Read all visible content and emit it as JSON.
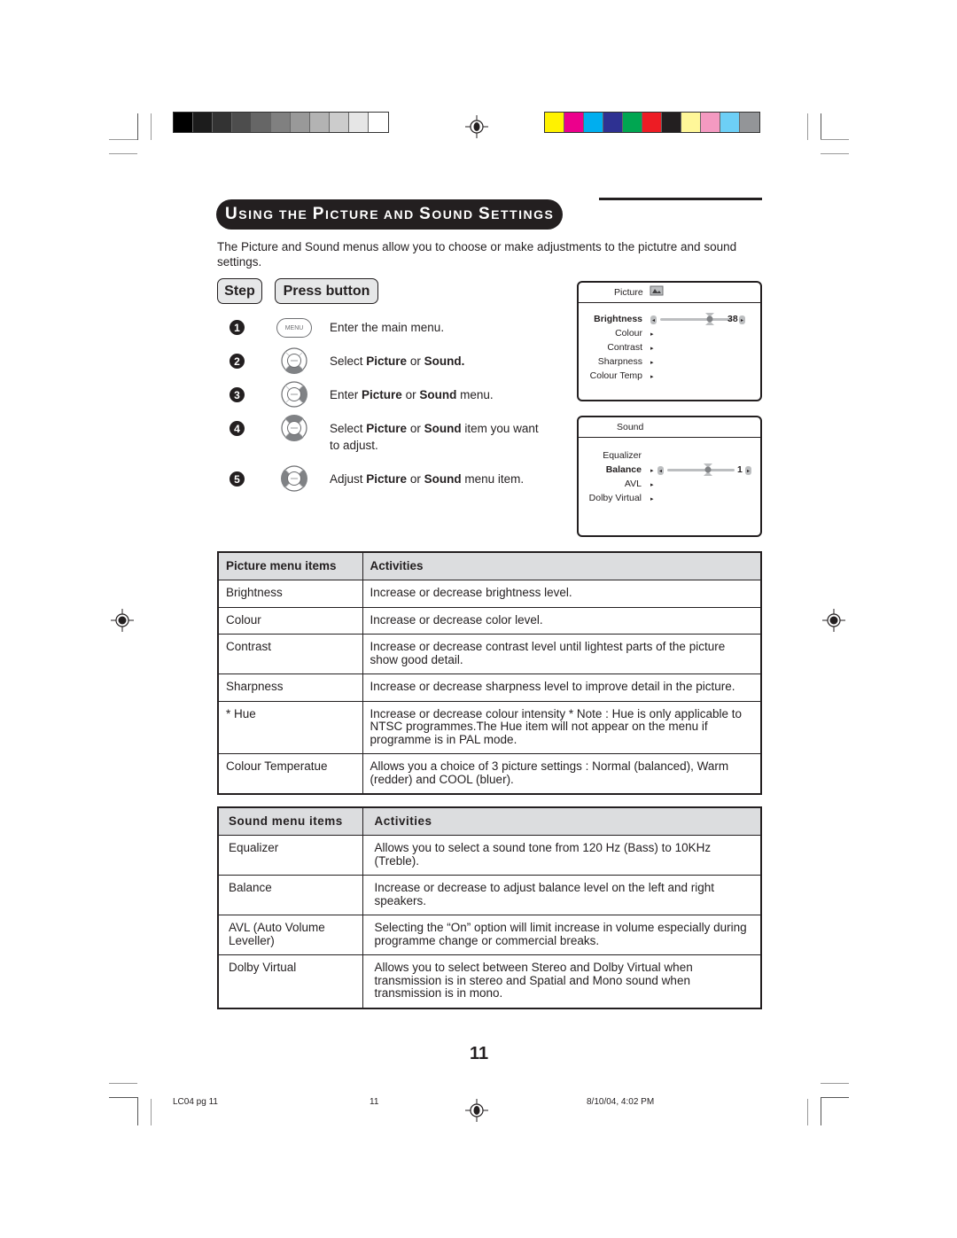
{
  "color_bars": {
    "grayscale": [
      "#000000",
      "#1c1c1c",
      "#333333",
      "#4d4d4d",
      "#666666",
      "#808080",
      "#999999",
      "#b3b3b3",
      "#cccccc",
      "#e6e6e6",
      "#ffffff"
    ],
    "process": [
      "#fff200",
      "#ec008c",
      "#00aeef",
      "#2e3192",
      "#00a651",
      "#ed1c24",
      "#231f20",
      "#fff799",
      "#f49ac1",
      "#6dcff6",
      "#939598"
    ]
  },
  "heading": {
    "parts": [
      {
        "cap": "U",
        "rest": "SING THE "
      },
      {
        "cap": "P",
        "rest": "ICTURE AND "
      },
      {
        "cap": "S",
        "rest": "OUND "
      },
      {
        "cap": "S",
        "rest": "ETTINGS"
      }
    ]
  },
  "intro": "The Picture and Sound menus allow you to choose or make adjustments to the pictutre and sound settings.",
  "step_header": "Step",
  "press_header": "Press button",
  "steps": [
    {
      "num": "1",
      "button": "MENU",
      "button_icon": "menu-button-icon",
      "pre": "Enter the main menu.",
      "bold1": "",
      "mid": "",
      "bold2": "",
      "post": ""
    },
    {
      "num": "2",
      "button": "",
      "button_icon": "nav-down-button-icon",
      "pre": "Select ",
      "bold1": "Picture",
      "mid": " or ",
      "bold2": "Sound.",
      "post": ""
    },
    {
      "num": "3",
      "button": "",
      "button_icon": "nav-right-button-icon",
      "pre": "Enter ",
      "bold1": "Picture",
      "mid": " or ",
      "bold2": "Sound",
      "post": " menu."
    },
    {
      "num": "4",
      "button": "",
      "button_icon": "nav-up-down-button-icon",
      "pre": "Select ",
      "bold1": "Picture",
      "mid": " or ",
      "bold2": "Sound",
      "post": " item you want to adjust."
    },
    {
      "num": "5",
      "button": "",
      "button_icon": "nav-left-right-button-icon",
      "pre": "Adjust ",
      "bold1": "Picture",
      "mid": " or ",
      "bold2": "Sound",
      "post": " menu item."
    }
  ],
  "osd_picture": {
    "title": "Picture",
    "title_icon": "picture-icon",
    "items": [
      {
        "label": "Brightness",
        "active": true
      },
      {
        "label": "Colour",
        "active": false
      },
      {
        "label": "Contrast",
        "active": false
      },
      {
        "label": "Sharpness",
        "active": false
      },
      {
        "label": "Colour Temp",
        "active": false
      }
    ],
    "slider_value": "38",
    "slider_fraction": 0.7
  },
  "osd_sound": {
    "title": "Sound",
    "items": [
      {
        "label": "Equalizer",
        "active": false
      },
      {
        "label": "Balance",
        "active": true
      },
      {
        "label": "AVL",
        "active": false
      },
      {
        "label": "Dolby Virtual",
        "active": false
      }
    ],
    "slider_value": "1",
    "slider_fraction": 0.6
  },
  "picture_table": {
    "headers": [
      "Picture menu items",
      "Activities"
    ],
    "rows": [
      [
        "Brightness",
        "Increase or decrease brightness level."
      ],
      [
        "Colour",
        "Increase or decrease color level."
      ],
      [
        "Contrast",
        "Increase or decrease contrast level  until lightest parts of the picture show good detail."
      ],
      [
        "Sharpness",
        "Increase or decrease sharpness level to improve detail in the picture."
      ],
      [
        "* Hue",
        "Increase or decrease colour intensity * Note : Hue is only applicable to NTSC programmes.The Hue item will not appear on the menu if programme is in PAL mode."
      ],
      [
        "Colour Temperatue",
        "Allows you a choice of 3 picture settings : Normal (balanced), Warm (redder) and COOL (bluer)."
      ]
    ]
  },
  "sound_table": {
    "headers": [
      "Sound menu items",
      "Activities"
    ],
    "rows": [
      [
        "Equalizer",
        "Allows you to select a sound tone from 120 Hz (Bass) to 10KHz (Treble)."
      ],
      [
        "Balance",
        "Increase or decrease to adjust balance level on the left and right speakers."
      ],
      [
        "AVL (Auto Volume Leveller)",
        "Selecting the “On” option will limit increase in volume especially during programme change or commercial breaks."
      ],
      [
        "Dolby Virtual",
        "Allows you to select between Stereo and Dolby Virtual when transmission is in stereo and Spatial and Mono sound when transmission is in mono."
      ]
    ]
  },
  "page_number": "11",
  "footer": {
    "file": "LC04 pg 11",
    "page": "11",
    "timestamp": "8/10/04, 4:02 PM"
  }
}
